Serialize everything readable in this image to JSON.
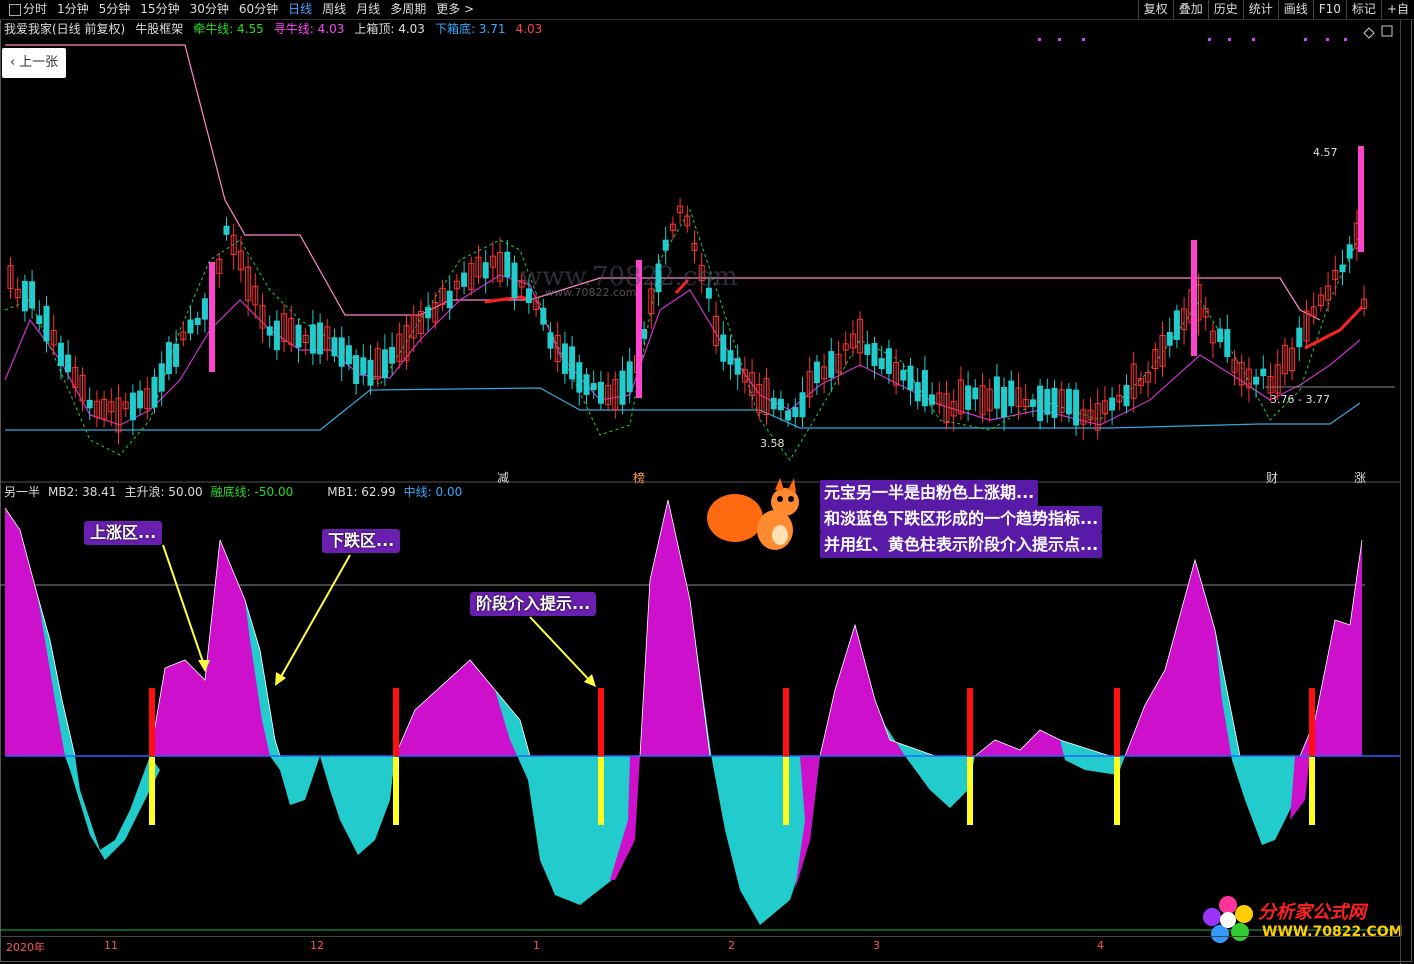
{
  "toolbar": {
    "left": [
      "分时",
      "1分钟",
      "5分钟",
      "15分钟",
      "30分钟",
      "60分钟",
      "日线",
      "周线",
      "月线",
      "多周期",
      "更多 >"
    ],
    "active_index": 6,
    "right": [
      "复权",
      "叠加",
      "历史",
      "统计",
      "画线",
      "F10",
      "标记",
      "+自"
    ]
  },
  "info": {
    "stock": "我爱我家(日线 前复权)",
    "framework": "牛股框架",
    "qianniu_label": "牵牛线: 4.55",
    "xunniu_label": "寻牛线: 4.03",
    "shangxiang_label": "上箱顶: 4.03",
    "xiaxiang_label": "下箱底: 3.71",
    "extra": "4.03"
  },
  "prev_button": "上一张",
  "price_labels": {
    "high": "4.57",
    "low": "3.58",
    "range": "3.76 - 3.77"
  },
  "markers": [
    "减",
    "榜",
    "财",
    "涨"
  ],
  "panel2": {
    "name": "另一半",
    "mb2": "MB2: 38.41",
    "zhusheng": "主升浪: 50.00",
    "rongdi": "融底线: -50.00",
    "mb1": "MB1: 62.99",
    "zhongxian": "中线: 0.00"
  },
  "annotations": {
    "up": "上涨区...",
    "down": "下跌区...",
    "entry": "阶段介入提示..."
  },
  "description": [
    "元宝另一半是由粉色上涨期...",
    "和淡蓝色下跌区形成的一个趋势指标...",
    "并用红、黄色柱表示阶段介入提示点..."
  ],
  "dates": [
    "2020年",
    "11",
    "12",
    "1",
    "2",
    "3",
    "4"
  ],
  "watermark": "www.70822.com",
  "watermark2": "www.70822.com",
  "logo": {
    "name": "分析家公式网",
    "url": "WWW.70822.COM"
  },
  "colors": {
    "up": "#cc10cc",
    "down": "#22cccc",
    "bar_red": "#ff1010",
    "bar_yellow": "#ffff20",
    "candle_up": "#ff3333",
    "candle_down": "#22cccc"
  }
}
